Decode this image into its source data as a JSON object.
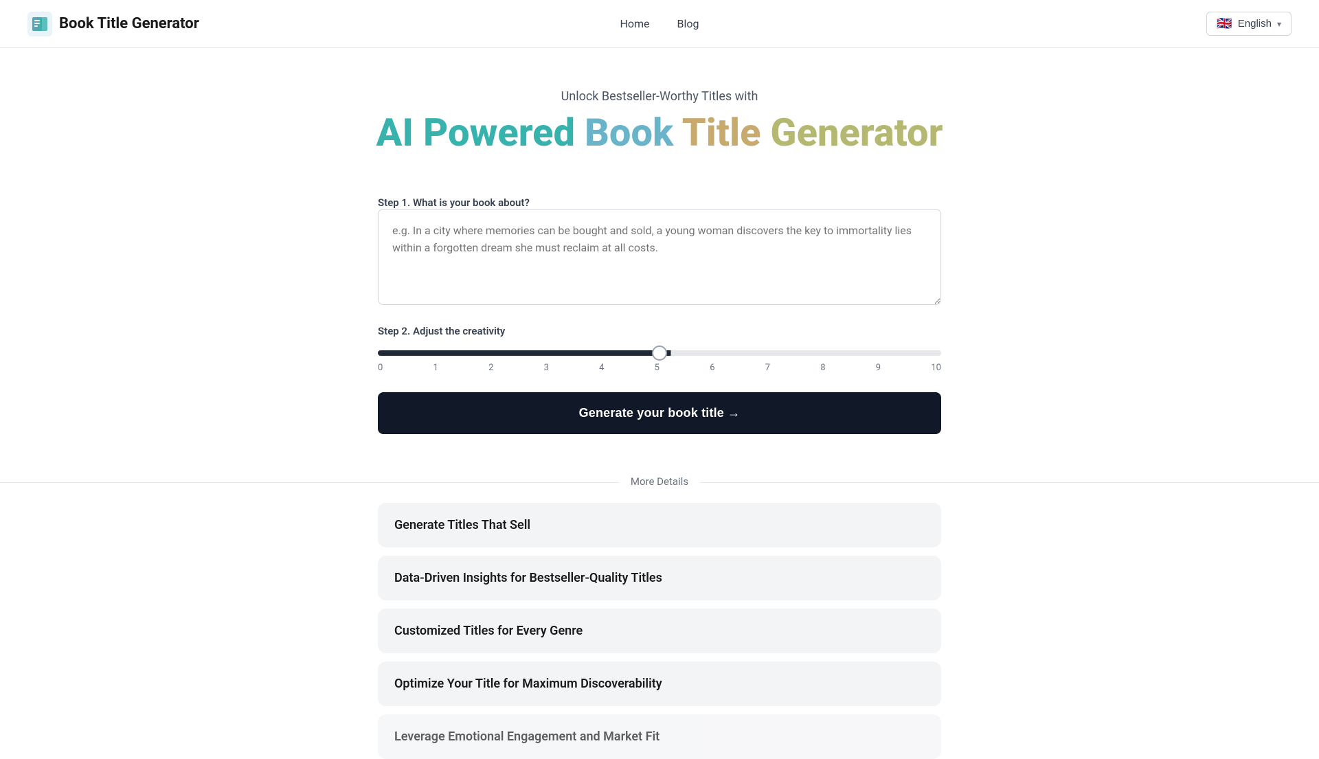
{
  "header": {
    "logo_alt": "Book Title Generator logo",
    "site_title": "Book Title Generator",
    "nav": {
      "home_label": "Home",
      "blog_label": "Blog"
    },
    "language": {
      "flag_emoji": "🇬🇧",
      "label": "English"
    }
  },
  "hero": {
    "subtitle": "Unlock Bestseller-Worthy Titles with",
    "title_word1": "AI",
    "title_word2": "Powered",
    "title_word3": "Book",
    "title_word4": "Title",
    "title_word5": "Generator"
  },
  "form": {
    "step1_label": "Step 1. What is your book about?",
    "textarea_placeholder": "e.g. In a city where memories can be bought and sold, a young woman discovers the key to immortality lies within a forgotten dream she must reclaim at all costs.",
    "step2_label": "Step 2. Adjust the creativity",
    "slider_min": 0,
    "slider_max": 10,
    "slider_value": 5,
    "slider_ticks": [
      "0",
      "1",
      "2",
      "3",
      "4",
      "5",
      "6",
      "7",
      "8",
      "9",
      "10"
    ],
    "generate_button_label": "Generate your book title →"
  },
  "more_details": {
    "section_label": "More Details",
    "cards": [
      {
        "label": "Generate Titles That Sell"
      },
      {
        "label": "Data-Driven Insights for Bestseller-Quality Titles"
      },
      {
        "label": "Customized Titles for Every Genre"
      },
      {
        "label": "Optimize Your Title for Maximum Discoverability"
      },
      {
        "label": "Leverage Emotional Engagement and Market Fit"
      }
    ]
  }
}
